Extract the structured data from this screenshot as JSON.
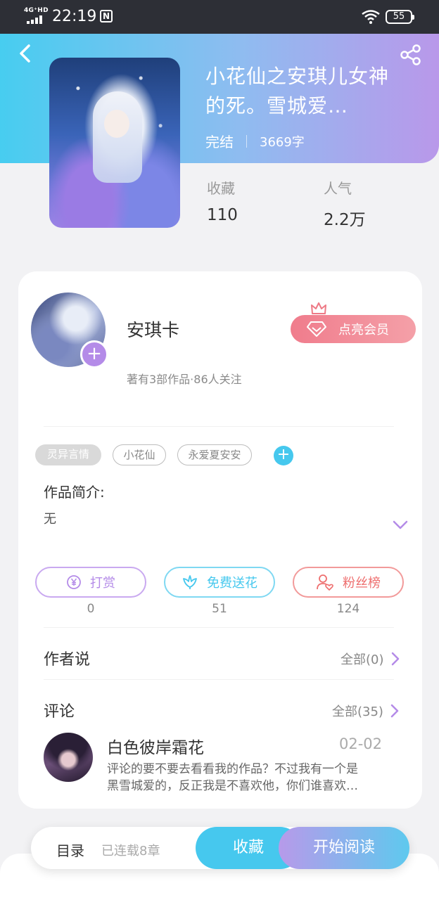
{
  "status_bar": {
    "network": "4G⁺HD",
    "time": "22:19",
    "nfc_icon": "N",
    "battery": "55"
  },
  "header": {
    "book_title": "小花仙之安琪儿女神的死。雪城爱…",
    "status": "完结",
    "word_count": "3669字",
    "stats": [
      {
        "label": "收藏",
        "value": "110"
      },
      {
        "label": "人气",
        "value": "2.2万"
      }
    ],
    "colors": {
      "gradient_start": "#47cdf0",
      "gradient_end": "#b998ea"
    }
  },
  "author": {
    "name": "安琪卡",
    "stats": "著有3部作品·86人关注",
    "member_button": "点亮会员"
  },
  "tags": [
    "灵异言情",
    "小花仙",
    "永爱夏安安"
  ],
  "intro": {
    "label": "作品简介:",
    "text": "无"
  },
  "actions": [
    {
      "label": "打赏",
      "count": "0",
      "icon": "yen-coin-icon",
      "color": "#b48be8"
    },
    {
      "label": "免费送花",
      "count": "51",
      "icon": "flower-icon",
      "color": "#46c8ee"
    },
    {
      "label": "粉丝榜",
      "count": "124",
      "icon": "fan-user-icon",
      "color": "#ee6f6f"
    }
  ],
  "author_says": {
    "title": "作者说",
    "all": "全部(0)"
  },
  "comments": {
    "title": "评论",
    "all": "全部(35)",
    "items": [
      {
        "user": "白色彼岸霜花",
        "date": "02-02",
        "line1": "评论的要不要去看看我的作品？不过我有一个是",
        "line2": "黑雪城爱的，反正我是不喜欢他，你们谁喜欢…"
      }
    ]
  },
  "bottom_bar": {
    "toc": "目录",
    "serial": "已连载8章",
    "collect": "收藏",
    "read": "开始阅读"
  }
}
